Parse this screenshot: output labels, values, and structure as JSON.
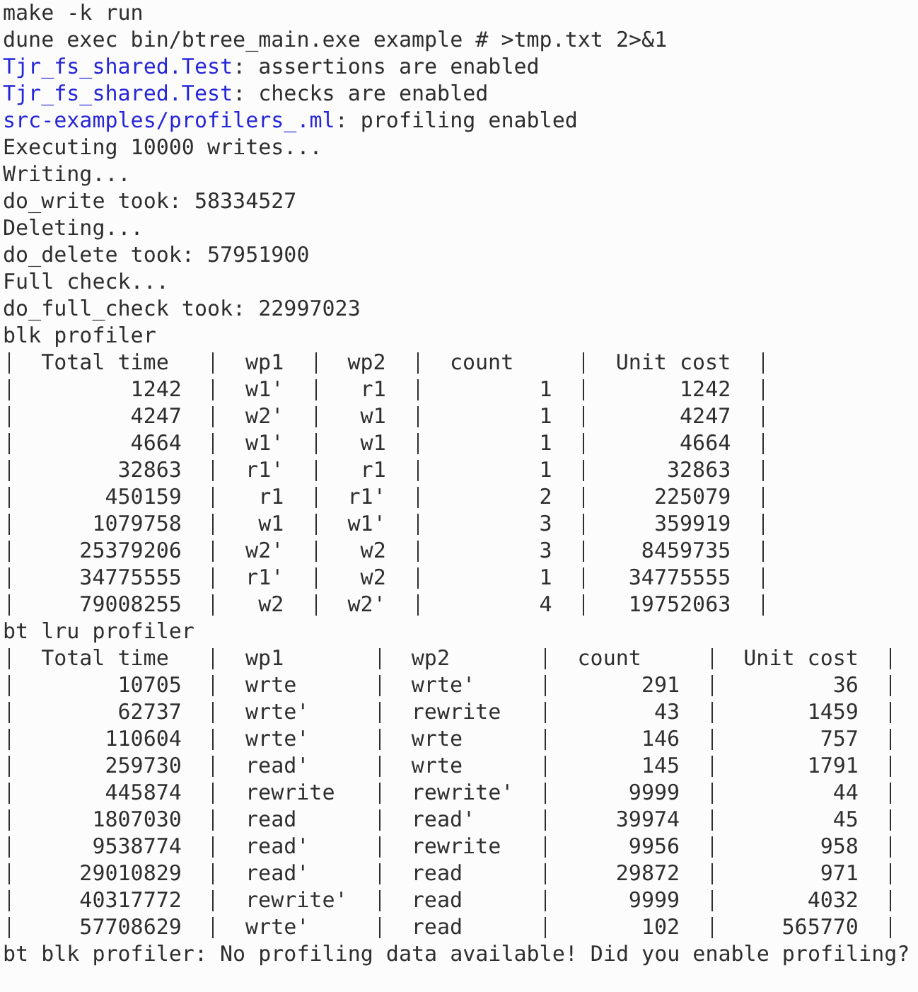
{
  "terminal": {
    "output": [
      {
        "kind": "text",
        "text": "make -k run"
      },
      {
        "kind": "text",
        "text": "dune exec bin/btree_main.exe example # >tmp.txt 2>&1"
      },
      {
        "kind": "source",
        "source": "Tjr_fs_shared.Test",
        "text": ": assertions are enabled"
      },
      {
        "kind": "source",
        "source": "Tjr_fs_shared.Test",
        "text": ": checks are enabled"
      },
      {
        "kind": "source",
        "source": "src-examples/profilers_.ml",
        "text": ": profiling enabled"
      },
      {
        "kind": "text",
        "text": "Executing 10000 writes..."
      },
      {
        "kind": "text",
        "text": "Writing..."
      },
      {
        "kind": "text",
        "text": "do_write took: 58334527"
      },
      {
        "kind": "text",
        "text": "Deleting..."
      },
      {
        "kind": "text",
        "text": "do_delete took: 57951900"
      },
      {
        "kind": "text",
        "text": "Full check..."
      },
      {
        "kind": "text",
        "text": "do_full_check took: 22997023"
      },
      {
        "kind": "text",
        "text": "blk profiler"
      },
      {
        "kind": "table",
        "columns": [
          "Total time",
          "wp1",
          "wp2",
          "count",
          "Unit cost"
        ],
        "rows": [
          [
            "1242",
            "w1'",
            "r1",
            "1",
            "1242"
          ],
          [
            "4247",
            "w2'",
            "w1",
            "1",
            "4247"
          ],
          [
            "4664",
            "w1'",
            "w1",
            "1",
            "4664"
          ],
          [
            "32863",
            "r1'",
            "r1",
            "1",
            "32863"
          ],
          [
            "450159",
            "r1",
            "r1'",
            "2",
            "225079"
          ],
          [
            "1079758",
            "w1",
            "w1'",
            "3",
            "359919"
          ],
          [
            "25379206",
            "w2'",
            "w2",
            "3",
            "8459735"
          ],
          [
            "34775555",
            "r1'",
            "w2",
            "1",
            "34775555"
          ],
          [
            "79008255",
            "w2",
            "w2'",
            "4",
            "19752063"
          ]
        ]
      },
      {
        "kind": "text",
        "text": "bt lru profiler"
      },
      {
        "kind": "table",
        "columns": [
          "Total time",
          "wp1",
          "wp2",
          "count",
          "Unit cost"
        ],
        "rows": [
          [
            "10705",
            "wrte",
            "wrte'",
            "291",
            "36"
          ],
          [
            "62737",
            "wrte'",
            "rewrite",
            "43",
            "1459"
          ],
          [
            "110604",
            "wrte'",
            "wrte",
            "146",
            "757"
          ],
          [
            "259730",
            "read'",
            "wrte",
            "145",
            "1791"
          ],
          [
            "445874",
            "rewrite",
            "rewrite'",
            "9999",
            "44"
          ],
          [
            "1807030",
            "read",
            "read'",
            "39974",
            "45"
          ],
          [
            "9538774",
            "read'",
            "rewrite",
            "9956",
            "958"
          ],
          [
            "29010829",
            "read'",
            "read",
            "29872",
            "971"
          ],
          [
            "40317772",
            "rewrite'",
            "read",
            "9999",
            "4032"
          ],
          [
            "57708629",
            "wrte'",
            "read",
            "102",
            "565770"
          ]
        ]
      },
      {
        "kind": "text",
        "text": "bt blk profiler: No profiling data available! Did you enable profiling?"
      }
    ]
  }
}
